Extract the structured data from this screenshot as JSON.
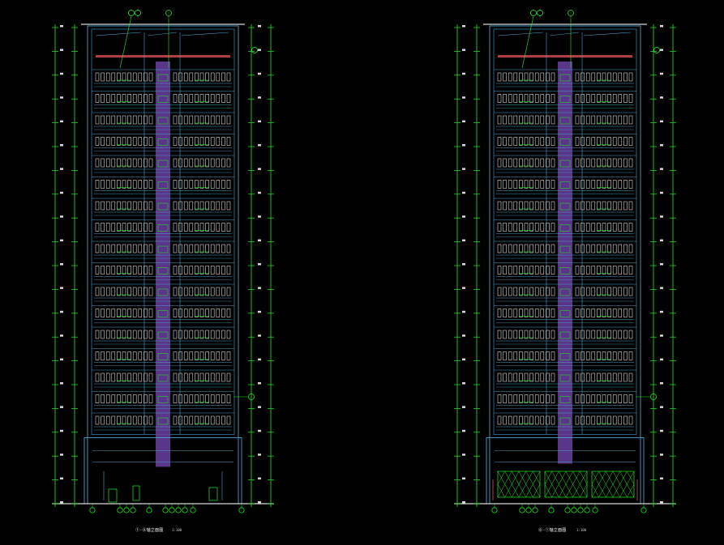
{
  "drawing": {
    "background": "#000000",
    "colors": {
      "outline": "#4aa0c8",
      "window": "#d8d8d8",
      "dimension": "#22ee22",
      "core": "#6a3fa0",
      "roof_band": "#b04040",
      "text": "#ffffff"
    },
    "floors_upper": 17,
    "elevations": [
      {
        "id": "left",
        "title": "①-⑧轴立面图",
        "scale": "1:100",
        "storefront": "doors"
      },
      {
        "id": "right",
        "title": "⑧-①轴立面图",
        "scale": "1:100",
        "storefront": "grille"
      }
    ]
  }
}
